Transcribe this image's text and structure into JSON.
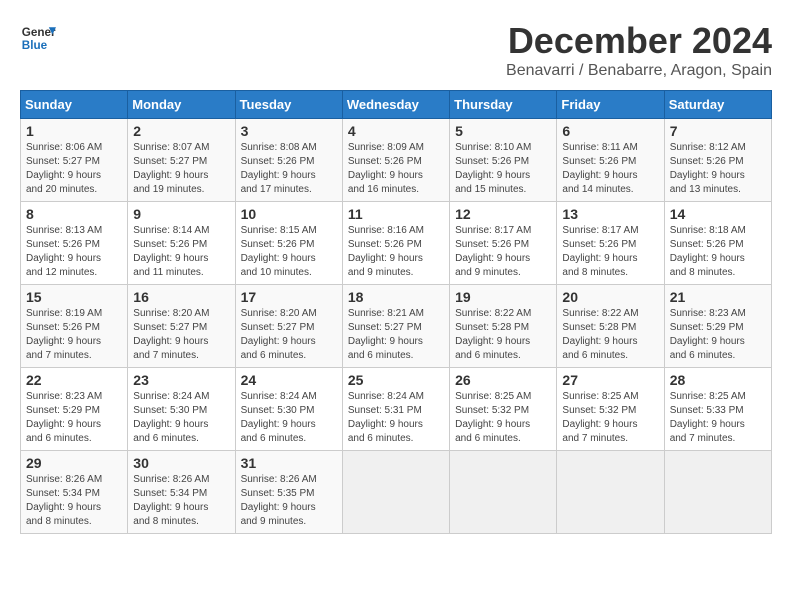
{
  "header": {
    "logo_line1": "General",
    "logo_line2": "Blue",
    "title": "December 2024",
    "subtitle": "Benavarri / Benabarre, Aragon, Spain"
  },
  "calendar": {
    "days_of_week": [
      "Sunday",
      "Monday",
      "Tuesday",
      "Wednesday",
      "Thursday",
      "Friday",
      "Saturday"
    ],
    "weeks": [
      [
        {
          "day": "",
          "info": ""
        },
        {
          "day": "2",
          "info": "Sunrise: 8:07 AM\nSunset: 5:27 PM\nDaylight: 9 hours\nand 19 minutes."
        },
        {
          "day": "3",
          "info": "Sunrise: 8:08 AM\nSunset: 5:26 PM\nDaylight: 9 hours\nand 17 minutes."
        },
        {
          "day": "4",
          "info": "Sunrise: 8:09 AM\nSunset: 5:26 PM\nDaylight: 9 hours\nand 16 minutes."
        },
        {
          "day": "5",
          "info": "Sunrise: 8:10 AM\nSunset: 5:26 PM\nDaylight: 9 hours\nand 15 minutes."
        },
        {
          "day": "6",
          "info": "Sunrise: 8:11 AM\nSunset: 5:26 PM\nDaylight: 9 hours\nand 14 minutes."
        },
        {
          "day": "7",
          "info": "Sunrise: 8:12 AM\nSunset: 5:26 PM\nDaylight: 9 hours\nand 13 minutes."
        }
      ],
      [
        {
          "day": "8",
          "info": "Sunrise: 8:13 AM\nSunset: 5:26 PM\nDaylight: 9 hours\nand 12 minutes."
        },
        {
          "day": "9",
          "info": "Sunrise: 8:14 AM\nSunset: 5:26 PM\nDaylight: 9 hours\nand 11 minutes."
        },
        {
          "day": "10",
          "info": "Sunrise: 8:15 AM\nSunset: 5:26 PM\nDaylight: 9 hours\nand 10 minutes."
        },
        {
          "day": "11",
          "info": "Sunrise: 8:16 AM\nSunset: 5:26 PM\nDaylight: 9 hours\nand 9 minutes."
        },
        {
          "day": "12",
          "info": "Sunrise: 8:17 AM\nSunset: 5:26 PM\nDaylight: 9 hours\nand 9 minutes."
        },
        {
          "day": "13",
          "info": "Sunrise: 8:17 AM\nSunset: 5:26 PM\nDaylight: 9 hours\nand 8 minutes."
        },
        {
          "day": "14",
          "info": "Sunrise: 8:18 AM\nSunset: 5:26 PM\nDaylight: 9 hours\nand 8 minutes."
        }
      ],
      [
        {
          "day": "15",
          "info": "Sunrise: 8:19 AM\nSunset: 5:26 PM\nDaylight: 9 hours\nand 7 minutes."
        },
        {
          "day": "16",
          "info": "Sunrise: 8:20 AM\nSunset: 5:27 PM\nDaylight: 9 hours\nand 7 minutes."
        },
        {
          "day": "17",
          "info": "Sunrise: 8:20 AM\nSunset: 5:27 PM\nDaylight: 9 hours\nand 6 minutes."
        },
        {
          "day": "18",
          "info": "Sunrise: 8:21 AM\nSunset: 5:27 PM\nDaylight: 9 hours\nand 6 minutes."
        },
        {
          "day": "19",
          "info": "Sunrise: 8:22 AM\nSunset: 5:28 PM\nDaylight: 9 hours\nand 6 minutes."
        },
        {
          "day": "20",
          "info": "Sunrise: 8:22 AM\nSunset: 5:28 PM\nDaylight: 9 hours\nand 6 minutes."
        },
        {
          "day": "21",
          "info": "Sunrise: 8:23 AM\nSunset: 5:29 PM\nDaylight: 9 hours\nand 6 minutes."
        }
      ],
      [
        {
          "day": "22",
          "info": "Sunrise: 8:23 AM\nSunset: 5:29 PM\nDaylight: 9 hours\nand 6 minutes."
        },
        {
          "day": "23",
          "info": "Sunrise: 8:24 AM\nSunset: 5:30 PM\nDaylight: 9 hours\nand 6 minutes."
        },
        {
          "day": "24",
          "info": "Sunrise: 8:24 AM\nSunset: 5:30 PM\nDaylight: 9 hours\nand 6 minutes."
        },
        {
          "day": "25",
          "info": "Sunrise: 8:24 AM\nSunset: 5:31 PM\nDaylight: 9 hours\nand 6 minutes."
        },
        {
          "day": "26",
          "info": "Sunrise: 8:25 AM\nSunset: 5:32 PM\nDaylight: 9 hours\nand 6 minutes."
        },
        {
          "day": "27",
          "info": "Sunrise: 8:25 AM\nSunset: 5:32 PM\nDaylight: 9 hours\nand 7 minutes."
        },
        {
          "day": "28",
          "info": "Sunrise: 8:25 AM\nSunset: 5:33 PM\nDaylight: 9 hours\nand 7 minutes."
        }
      ],
      [
        {
          "day": "29",
          "info": "Sunrise: 8:26 AM\nSunset: 5:34 PM\nDaylight: 9 hours\nand 8 minutes."
        },
        {
          "day": "30",
          "info": "Sunrise: 8:26 AM\nSunset: 5:34 PM\nDaylight: 9 hours\nand 8 minutes."
        },
        {
          "day": "31",
          "info": "Sunrise: 8:26 AM\nSunset: 5:35 PM\nDaylight: 9 hours\nand 9 minutes."
        },
        {
          "day": "",
          "info": ""
        },
        {
          "day": "",
          "info": ""
        },
        {
          "day": "",
          "info": ""
        },
        {
          "day": "",
          "info": ""
        }
      ]
    ],
    "week1_day1": {
      "day": "1",
      "info": "Sunrise: 8:06 AM\nSunset: 5:27 PM\nDaylight: 9 hours\nand 20 minutes."
    }
  }
}
